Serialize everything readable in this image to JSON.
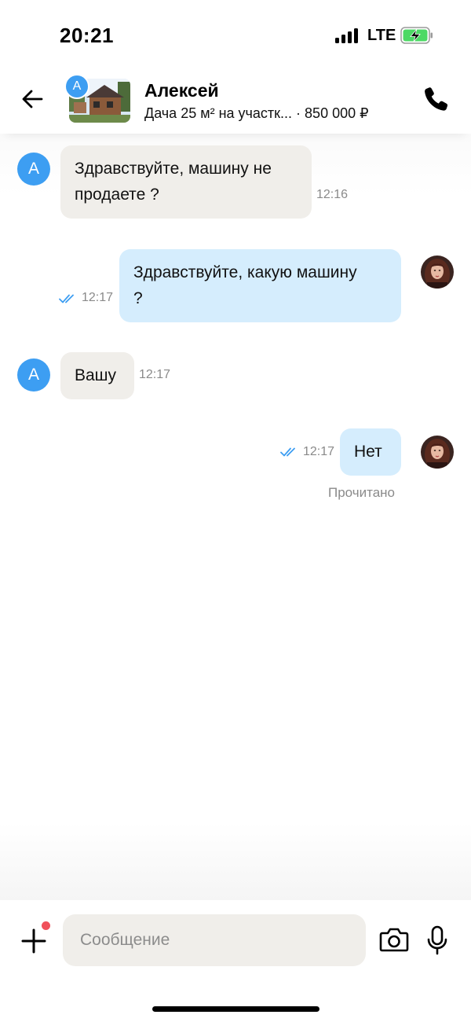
{
  "status_bar": {
    "time": "20:21",
    "network": "LTE"
  },
  "header": {
    "avatar_letter": "А",
    "name": "Алексей",
    "listing": "Дача 25 м² на участк... · 850 000 ₽"
  },
  "messages": [
    {
      "direction": "in",
      "avatar_letter": "А",
      "lines": [
        "Здравствуйте, машину не",
        "продаете ?"
      ],
      "time": "12:16"
    },
    {
      "direction": "out",
      "lines": [
        "Здравствуйте, какую машину",
        "?"
      ],
      "time": "12:17"
    },
    {
      "direction": "in",
      "avatar_letter": "А",
      "lines": [
        "Вашу"
      ],
      "time": "12:17"
    },
    {
      "direction": "out",
      "lines": [
        "Нет"
      ],
      "time": "12:17",
      "status": "Прочитано"
    }
  ],
  "input": {
    "placeholder": "Сообщение"
  },
  "colors": {
    "accent": "#3d9ef2",
    "incoming_bubble": "#f0eeea",
    "outgoing_bubble": "#d5edfd",
    "notification": "#f0505a"
  }
}
